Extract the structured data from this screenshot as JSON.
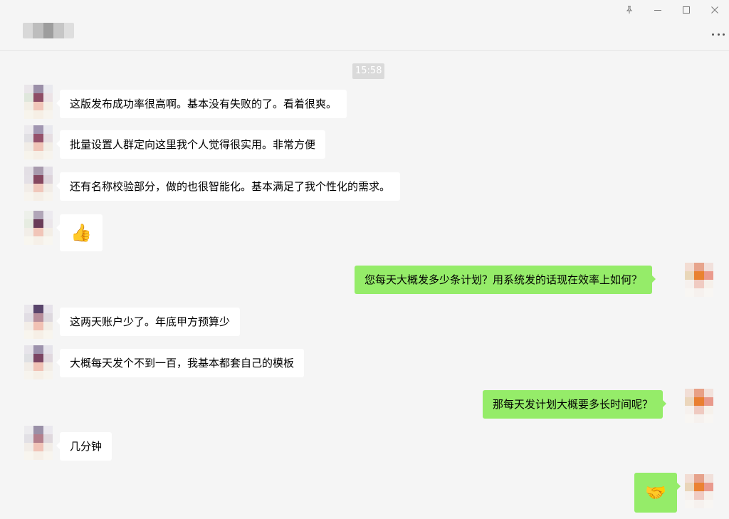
{
  "window": {
    "controls": {
      "pin": "pin-icon",
      "minimize": "minimize-icon",
      "maximize": "maximize-icon",
      "close": "close-icon"
    },
    "more": "more-icon"
  },
  "chat": {
    "timestamp": "15:58",
    "colors": {
      "incoming": "#ffffff",
      "outgoing": "#95ec69",
      "background": "#f5f5f5"
    },
    "messages": [
      {
        "side": "in",
        "text": "这版发布成功率很高啊。基本没有失败的了。看着很爽。"
      },
      {
        "side": "in",
        "text": "批量设置人群定向这里我个人觉得很实用。非常方便"
      },
      {
        "side": "in",
        "text": "还有名称校验部分，做的也很智能化。基本满足了我个性化的需求。"
      },
      {
        "side": "in",
        "text": "👍",
        "icon": "thumbs-up-icon"
      },
      {
        "side": "out",
        "text": "您每天大概发多少条计划？用系统发的话现在效率上如何？"
      },
      {
        "side": "in",
        "text": "这两天账户少了。年底甲方预算少"
      },
      {
        "side": "in",
        "text": "大概每天发个不到一百，我基本都套自己的模板"
      },
      {
        "side": "out",
        "text": "那每天发计划大概要多长时间呢？"
      },
      {
        "side": "in",
        "text": "几分钟"
      },
      {
        "side": "out",
        "text": "🤝",
        "icon": "handshake-icon"
      }
    ]
  }
}
